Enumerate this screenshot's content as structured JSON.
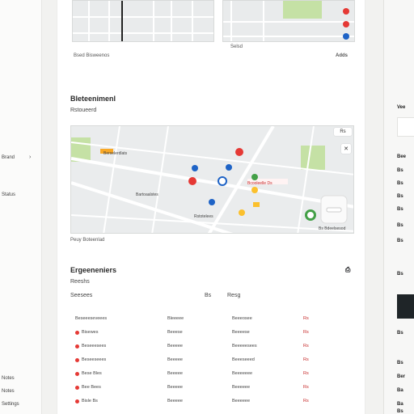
{
  "left_rail": {
    "items": [
      "Brand",
      "Status",
      "Notes",
      "Notes",
      "Settings"
    ]
  },
  "top_map": {
    "left_caption": "Bsed Bisweenos",
    "right_caption": "Selsd",
    "right_label": "Adds"
  },
  "directions": {
    "title": "Bleteenimenl",
    "subtitle": "Rstoueerd",
    "caption": "Peuy Boteenlad",
    "map_labels": [
      "Berselerdlats",
      "Bcooleelle Ds",
      "Bartoaalstes",
      "Rstotelees"
    ],
    "attribution": "Bs Bdeelsesod",
    "controls": {
      "close": "✕",
      "zoom_label": "Rs"
    }
  },
  "recent": {
    "title": "Ergeeneniers",
    "subtitle": "Reeshs",
    "filter_label": "Seesees",
    "filter_value": "Resg",
    "filter_icon_label": "Bs",
    "print_icon_label": "⎙",
    "rows": [
      {
        "c1": "Beseeeseveees",
        "c2": "Bleeeee",
        "c3": "Beeeosee",
        "c4": "Rs",
        "status": ""
      },
      {
        "c1": "Bisewes",
        "c2": "Beeese",
        "c3": "Beeeese",
        "c4": "Rs",
        "status": "red"
      },
      {
        "c1": "Beseeesees",
        "c2": "Beeeee",
        "c3": "Beeeeesees",
        "c4": "Rs",
        "status": "red"
      },
      {
        "c1": "Beseeseees",
        "c2": "Beeeee",
        "c3": "Beeeseeed",
        "c4": "Rs",
        "status": "red"
      },
      {
        "c1": "Bese  Bles",
        "c2": "Beeeee",
        "c3": "Beeeeeee",
        "c4": "Rs",
        "status": "red"
      },
      {
        "c1": "Bee  Bees",
        "c2": "Beeeee",
        "c3": "Beeeeee",
        "c4": "Rs",
        "status": "red"
      },
      {
        "c1": "Bisle   Bs",
        "c2": "Beeeee",
        "c3": "Beeeeee",
        "c4": "Rs",
        "status": "red"
      }
    ]
  },
  "right_rail": {
    "items": [
      "Vee",
      "Bee",
      "Bs",
      "Bs",
      "Bs",
      "Bs",
      "Bs",
      "Bs",
      "Bs",
      "Bs",
      "Bs",
      "Ber",
      "Ba",
      "Ba",
      "Bs"
    ]
  }
}
